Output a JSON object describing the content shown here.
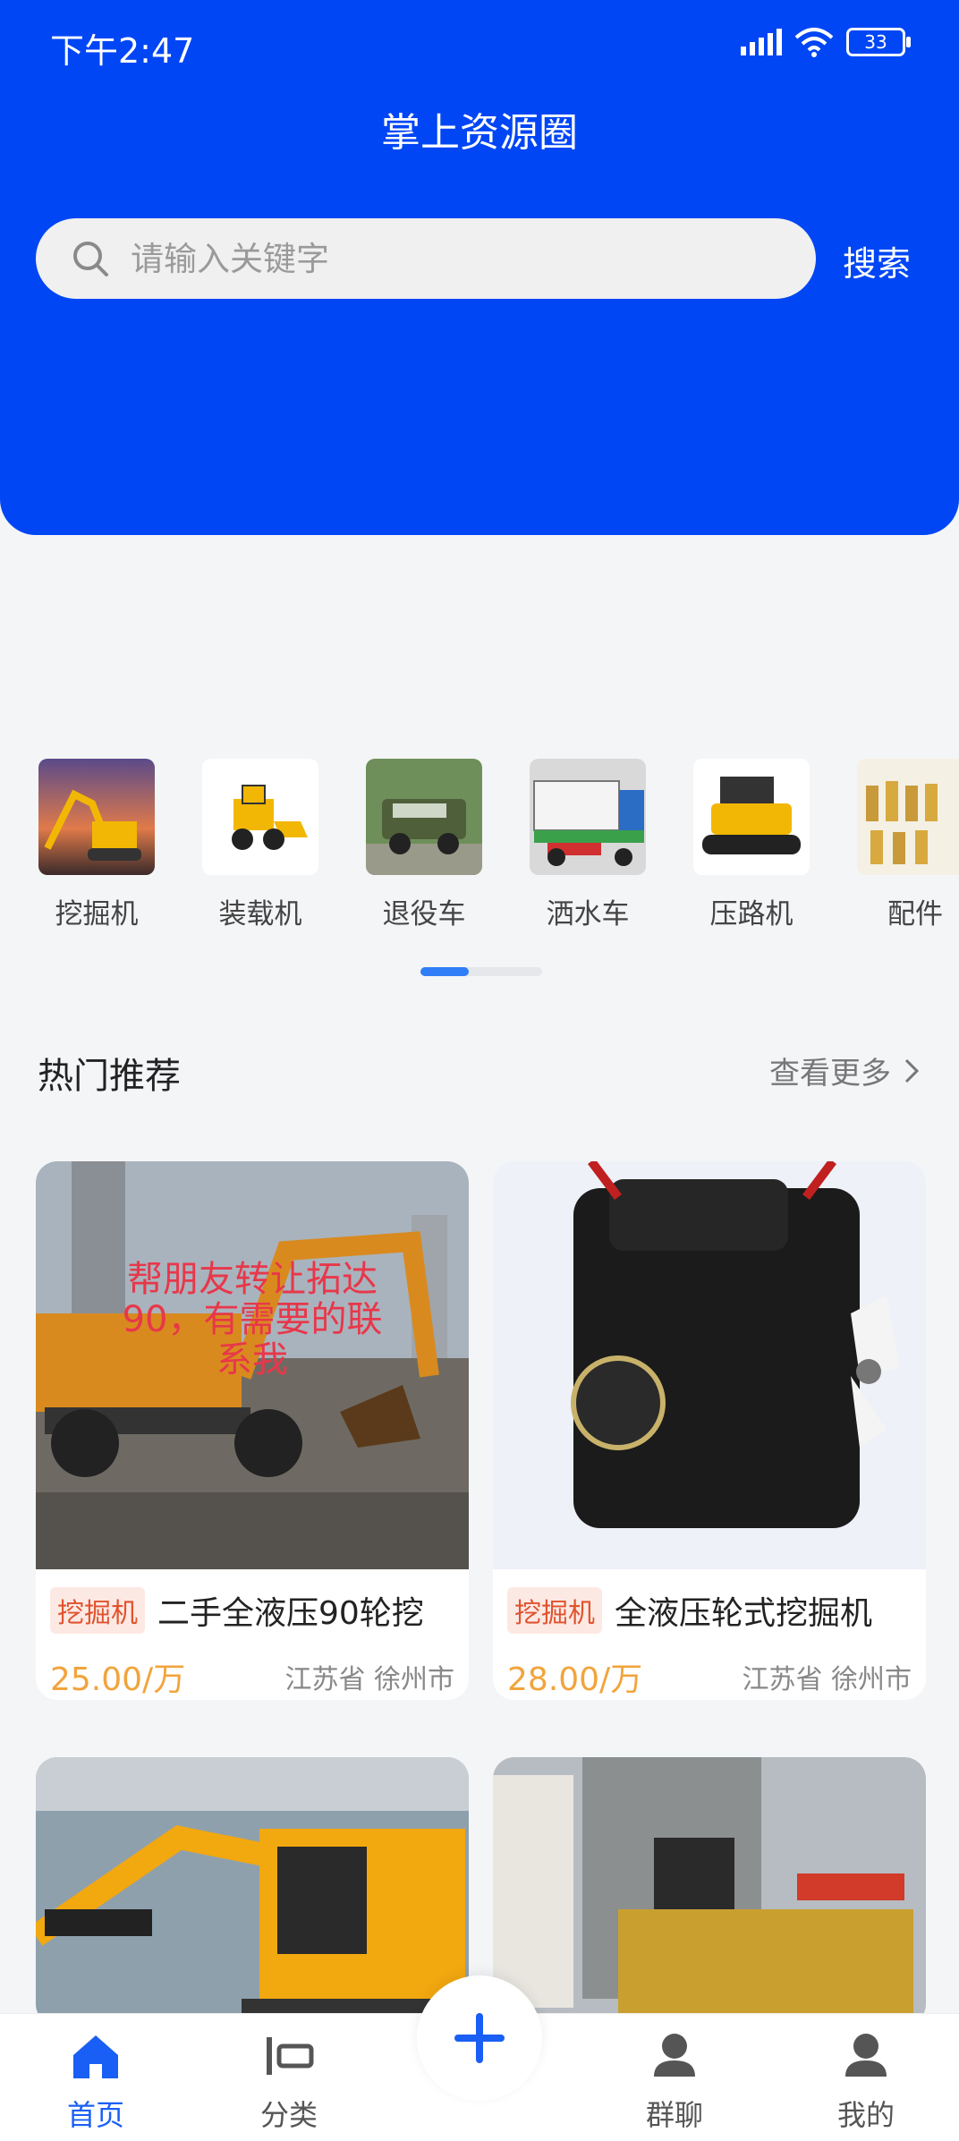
{
  "status_bar": {
    "time": "下午2:47",
    "battery": "33"
  },
  "header": {
    "title": "掌上资源圈"
  },
  "search": {
    "placeholder": "请输入关键字",
    "button_label": "搜索"
  },
  "categories": [
    {
      "label": "挖掘机"
    },
    {
      "label": "装载机"
    },
    {
      "label": "退役车"
    },
    {
      "label": "洒水车"
    },
    {
      "label": "压路机"
    },
    {
      "label": "配件"
    }
  ],
  "section": {
    "title": "热门推荐",
    "more_label": "查看更多"
  },
  "products": [
    {
      "tag": "挖掘机",
      "title": "二手全液压90轮挖",
      "price": "25.00/万",
      "location": "江苏省 徐州市",
      "image_caption": "帮朋友转让拓达90，有需要的联系我"
    },
    {
      "tag": "挖掘机",
      "title": "全液压轮式挖掘机",
      "price": "28.00/万",
      "location": "江苏省 徐州市"
    }
  ],
  "bottom_nav": [
    {
      "label": "首页",
      "active": true
    },
    {
      "label": "分类",
      "active": false
    },
    {
      "label": "群聊",
      "active": false
    },
    {
      "label": "我的",
      "active": false
    }
  ],
  "colors": {
    "brand": "#0046f5",
    "price": "#f1a43c",
    "tag": "#e0532e",
    "active_nav": "#1a5ff5"
  }
}
